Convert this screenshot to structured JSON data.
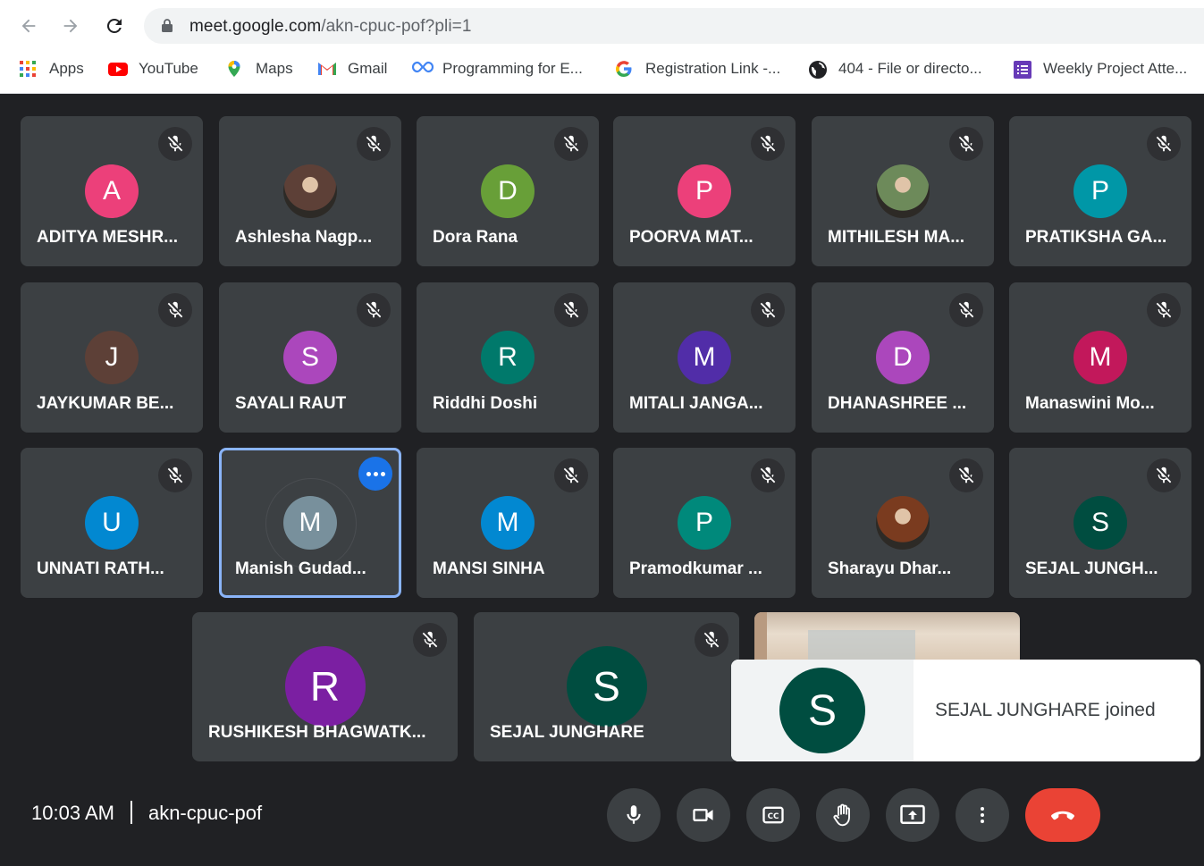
{
  "browser": {
    "url_host": "meet.google.com",
    "url_path": "/akn-cpuc-pof?pli=1",
    "bookmarks": [
      {
        "label": "Apps",
        "icon": "apps-grid-icon"
      },
      {
        "label": "YouTube",
        "icon": "youtube-icon"
      },
      {
        "label": "Maps",
        "icon": "maps-pin-icon"
      },
      {
        "label": "Gmail",
        "icon": "gmail-icon"
      },
      {
        "label": "Programming for E...",
        "icon": "infinity-icon"
      },
      {
        "label": "Registration Link -...",
        "icon": "google-g-icon"
      },
      {
        "label": "404 - File or directo...",
        "icon": "globe-icon"
      },
      {
        "label": "Weekly Project Atte...",
        "icon": "forms-icon"
      }
    ]
  },
  "participants": [
    {
      "name": "ADITYA MESHR...",
      "initial": "A",
      "color": "#ec407a"
    },
    {
      "name": "Ashlesha Nagp...",
      "initial": "",
      "color": "#5d4037"
    },
    {
      "name": "Dora Rana",
      "initial": "D",
      "color": "#689f38"
    },
    {
      "name": "POORVA MAT...",
      "initial": "P",
      "color": "#ec407a"
    },
    {
      "name": "MITHILESH MA...",
      "initial": "",
      "color": "#6d8a5a"
    },
    {
      "name": "PRATIKSHA GA...",
      "initial": "P",
      "color": "#0097a7"
    },
    {
      "name": "JAYKUMAR BE...",
      "initial": "J",
      "color": "#5d4037"
    },
    {
      "name": "SAYALI RAUT",
      "initial": "S",
      "color": "#ab47bc"
    },
    {
      "name": "Riddhi Doshi",
      "initial": "R",
      "color": "#00796b"
    },
    {
      "name": "MITALI JANGA...",
      "initial": "M",
      "color": "#512da8"
    },
    {
      "name": "DHANASHREE ...",
      "initial": "D",
      "color": "#ab47bc"
    },
    {
      "name": "Manaswini Mo...",
      "initial": "M",
      "color": "#c2185b"
    },
    {
      "name": "UNNATI RATH...",
      "initial": "U",
      "color": "#0288d1"
    },
    {
      "name": "Manish Gudad...",
      "initial": "M",
      "color": "#78909c"
    },
    {
      "name": "MANSI SINHA",
      "initial": "M",
      "color": "#0288d1"
    },
    {
      "name": "Pramodkumar ...",
      "initial": "P",
      "color": "#00897b"
    },
    {
      "name": "Sharayu Dhar...",
      "initial": "",
      "color": "#7a3b1f"
    },
    {
      "name": "SEJAL JUNGH...",
      "initial": "S",
      "color": "#004d40"
    },
    {
      "name": "RUSHIKESH BHAGWATK...",
      "initial": "R",
      "color": "#7b1fa2"
    },
    {
      "name": "SEJAL JUNGHARE",
      "initial": "S",
      "color": "#004d40"
    }
  ],
  "toast": {
    "initial": "S",
    "message": "SEJAL JUNGHARE joined"
  },
  "footer": {
    "time": "10:03 AM",
    "meeting_code": "akn-cpuc-pof"
  }
}
